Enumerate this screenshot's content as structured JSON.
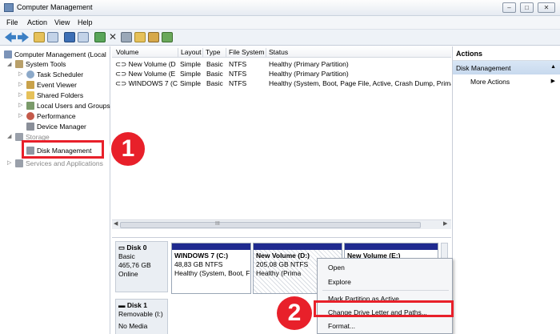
{
  "window": {
    "title": "Computer Management",
    "buttons": {
      "minimize": "–",
      "maximize": "□",
      "close": "✕"
    }
  },
  "menu": {
    "items": [
      "File",
      "Action",
      "View",
      "Help"
    ]
  },
  "toolbar": {
    "icons": [
      "back-arrow-icon",
      "forward-arrow-icon",
      "up-folder-icon",
      "show-tree-icon",
      "help-icon",
      "properties-icon",
      "refresh-icon",
      "delete-icon",
      "settings-icon",
      "open-folder-icon",
      "search-icon",
      "check-icon"
    ]
  },
  "tree": {
    "root": "Computer Management (Local",
    "system_tools": "System Tools",
    "task_scheduler": "Task Scheduler",
    "event_viewer": "Event Viewer",
    "shared_folders": "Shared Folders",
    "local_users": "Local Users and Groups",
    "performance": "Performance",
    "device_manager": "Device Manager",
    "storage": "Storage",
    "disk_management": "Disk Management",
    "services": "Services and Applications"
  },
  "volumes": {
    "headers": [
      "Volume",
      "Layout",
      "Type",
      "File System",
      "Status"
    ],
    "rows": [
      [
        "New Volume (D:)",
        "Simple",
        "Basic",
        "NTFS",
        "Healthy (Primary Partition)"
      ],
      [
        "New Volume (E:)",
        "Simple",
        "Basic",
        "NTFS",
        "Healthy (Primary Partition)"
      ],
      [
        "WINDOWS 7 (C:)",
        "Simple",
        "Basic",
        "NTFS",
        "Healthy (System, Boot, Page File, Active, Crash Dump, Prima"
      ]
    ],
    "scroll_glyph": "III"
  },
  "disks": {
    "disk0": {
      "name": "Disk 0",
      "type": "Basic",
      "size": "465,76 GB",
      "state": "Online"
    },
    "disk1": {
      "name": "Disk 1",
      "type": "Removable (I:)",
      "extra": "No Media"
    },
    "partitions": [
      {
        "name": "WINDOWS 7  (C:)",
        "size": "48,83 GB NTFS",
        "status": "Healthy (System, Boot, F"
      },
      {
        "name": "New Volume  (D:)",
        "size": "205,08 GB NTFS",
        "status": "Healthy (Prima"
      },
      {
        "name": "New Volume  (E:)",
        "size": "",
        "status": ""
      }
    ]
  },
  "actions": {
    "header": "Actions",
    "section": "Disk Management",
    "more": "More Actions"
  },
  "context_menu": {
    "items": [
      "Open",
      "Explore",
      "Mark Partition as Active",
      "Change Drive Letter and Paths...",
      "Format..."
    ]
  },
  "annotations": {
    "step1": "1",
    "step2": "2",
    "highlight_color": "#e8202a"
  }
}
